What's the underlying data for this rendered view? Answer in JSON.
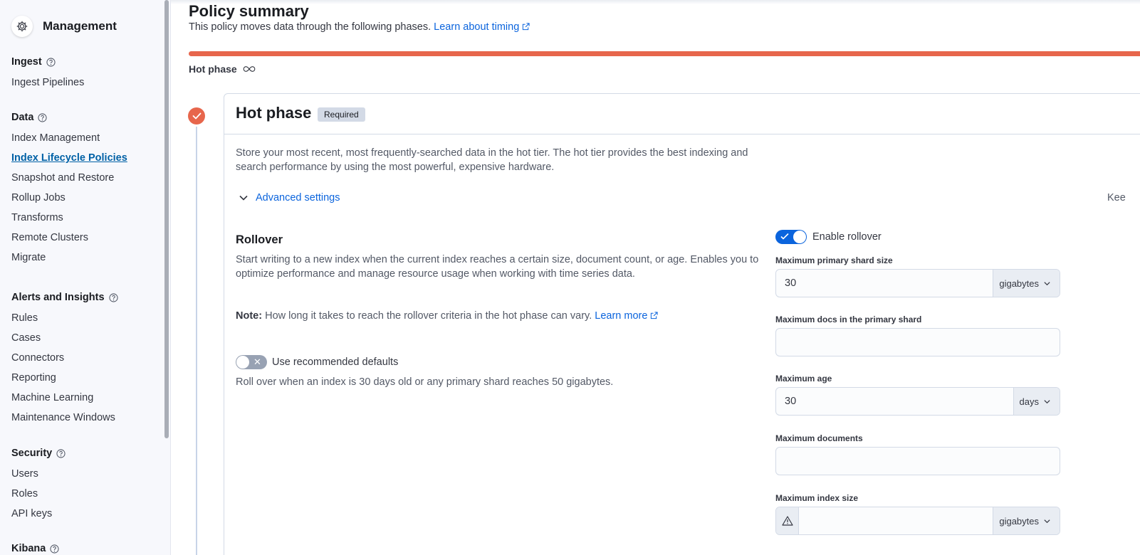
{
  "sidebar": {
    "title": "Management",
    "groups": [
      {
        "label": "Ingest",
        "items": [
          "Ingest Pipelines"
        ]
      },
      {
        "label": "Data",
        "items": [
          "Index Management",
          "Index Lifecycle Policies",
          "Snapshot and Restore",
          "Rollup Jobs",
          "Transforms",
          "Remote Clusters",
          "Migrate"
        ]
      },
      {
        "label": "Alerts and Insights",
        "items": [
          "Rules",
          "Cases",
          "Connectors",
          "Reporting",
          "Machine Learning",
          "Maintenance Windows"
        ]
      },
      {
        "label": "Security",
        "items": [
          "Users",
          "Roles",
          "API keys"
        ]
      },
      {
        "label": "Kibana"
      }
    ],
    "active_item": "Index Lifecycle Policies"
  },
  "summary": {
    "title": "Policy summary",
    "description": "This policy moves data through the following phases.",
    "timing_link": "Learn about timing",
    "phase_bar_color": "#e7664c",
    "phase_bar_label": "Hot phase"
  },
  "hot_phase": {
    "title": "Hot phase",
    "badge": "Required",
    "description": "Store your most recent, most frequently-searched data in the hot tier. The hot tier provides the best indexing and search performance by using the most powerful, expensive hardware.",
    "advanced_settings": "Advanced settings",
    "right_truncated": "Kee"
  },
  "rollover": {
    "title": "Rollover",
    "description": "Start writing to a new index when the current index reaches a certain size, document count, or age. Enables you to optimize performance and manage resource usage when working with time series data.",
    "note_label": "Note:",
    "note_text": "How long it takes to reach the rollover criteria in the hot phase can vary.",
    "learn_more": "Learn more",
    "recommended_label": "Use recommended defaults",
    "recommended_enabled": false,
    "recommended_desc": "Roll over when an index is 30 days old or any primary shard reaches 50 gigabytes.",
    "enable_label": "Enable rollover",
    "enable_enabled": true
  },
  "fields": {
    "max_primary_shard_size": {
      "label": "Maximum primary shard size",
      "value": "30",
      "unit": "gigabytes"
    },
    "max_docs_primary_shard": {
      "label": "Maximum docs in the primary shard",
      "value": ""
    },
    "max_age": {
      "label": "Maximum age",
      "value": "30",
      "unit": "days"
    },
    "max_documents": {
      "label": "Maximum documents",
      "value": ""
    },
    "max_index_size": {
      "label": "Maximum index size",
      "value": "",
      "unit": "gigabytes"
    }
  },
  "colors": {
    "accent": "#0b64dd",
    "hot": "#e7664c"
  }
}
